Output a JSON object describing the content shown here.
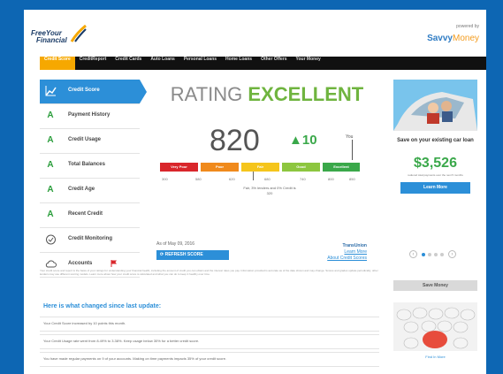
{
  "header": {
    "logo_line1": "FreeYour",
    "logo_line2": "Financial",
    "partner_small": "powered by",
    "partner_name_1": "Savvy",
    "partner_name_2": "Money"
  },
  "nav": {
    "items": [
      "Credit Score",
      "CreditReport",
      "Credit Cards",
      "Auto Loans",
      "Personal Loans",
      "Home Loans",
      "Other Offers",
      "Your Money"
    ],
    "active_index": 0
  },
  "sidebar": {
    "items": [
      {
        "label": "Credit Score",
        "grade": "",
        "icon": "chart-icon"
      },
      {
        "label": "Payment History",
        "grade": "A"
      },
      {
        "label": "Credit Usage",
        "grade": "A"
      },
      {
        "label": "Total Balances",
        "grade": "A"
      },
      {
        "label": "Credit Age",
        "grade": "A"
      },
      {
        "label": "Recent Credit",
        "grade": "A"
      },
      {
        "label": "Credit Monitoring",
        "grade": "",
        "icon": "lock-icon"
      },
      {
        "label": "Accounts",
        "grade": "",
        "icon": "cloud-icon"
      }
    ],
    "active_index": 0
  },
  "score": {
    "rating_prefix": "RATING",
    "rating_word": "EXCELLENT",
    "value": "820",
    "delta": "▲10",
    "you_label": "You",
    "segments": [
      {
        "label": "Very Poor",
        "color": "#d9262b"
      },
      {
        "label": "Poor",
        "color": "#f08a1c"
      },
      {
        "label": "Fair",
        "color": "#f5c51c"
      },
      {
        "label": "Good",
        "color": "#8dc63f"
      },
      {
        "label": "Excellent",
        "color": "#3aa84a"
      }
    ],
    "ticks": [
      "300",
      "580",
      "620",
      "680",
      "740",
      "800",
      "850"
    ],
    "note": "Fair, 3% lenders and 0% Credit is 320",
    "as_of": "As of May 09, 2016",
    "refresh_label": "REFRESH SCORE",
    "powered_title": "TransUnion",
    "powered_link1": "Learn More",
    "powered_link2": "About Credit Scores"
  },
  "right_ad": {
    "headline": "Save on your existing car loan",
    "amount": "$3,526",
    "sub": "reduced total payments over the next 5 months",
    "button": "Learn More",
    "save_money_title": "Save Money",
    "caption": "Find In More"
  },
  "disclaimer": "Your credit score and report is the basis of your ratings for understanding your financial health, including the amount of credit you can obtain and the interest rates you pay. Information provided is accurate as of the date shown and may change. Scores and grades update periodically; other lenders may use different scoring models. Learn more about how your credit score is calculated and what you can do to keep it healthy over time.",
  "changes": {
    "title": "Here is what changed since last update:",
    "items": [
      "Your Credit Score increased by 10 points this month.",
      "Your Credit Usage rate went from 8.49% to 3.38%. Keep usage below 30% for a better credit score.",
      "You have made regular payments on 9 of your accounts. Making on time payments impacts 35% of your credit score."
    ]
  }
}
